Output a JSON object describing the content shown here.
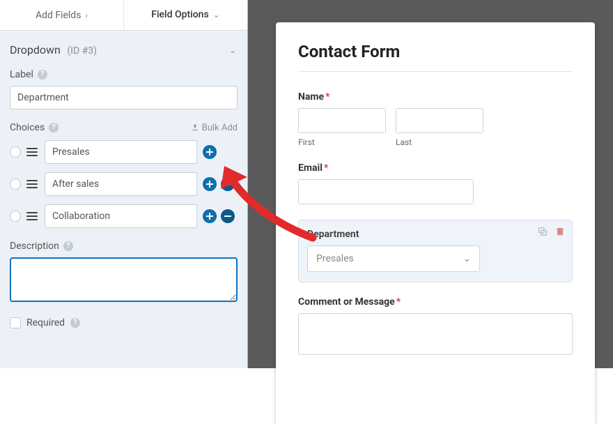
{
  "tabs": {
    "add_fields": "Add Fields",
    "field_options": "Field Options"
  },
  "section": {
    "title": "Dropdown",
    "id": "(ID #3)"
  },
  "labels": {
    "label": "Label",
    "choices": "Choices",
    "bulk": "Bulk Add",
    "description": "Description",
    "required": "Required"
  },
  "fields": {
    "label_value": "Department",
    "description_value": ""
  },
  "choices": [
    {
      "value": "Presales"
    },
    {
      "value": "After sales"
    },
    {
      "value": "Collaboration"
    }
  ],
  "preview": {
    "title": "Contact Form",
    "name": {
      "label": "Name",
      "first": "First",
      "last": "Last"
    },
    "email_label": "Email",
    "department": {
      "label": "Department",
      "selected": "Presales"
    },
    "comment_label": "Comment or Message"
  }
}
